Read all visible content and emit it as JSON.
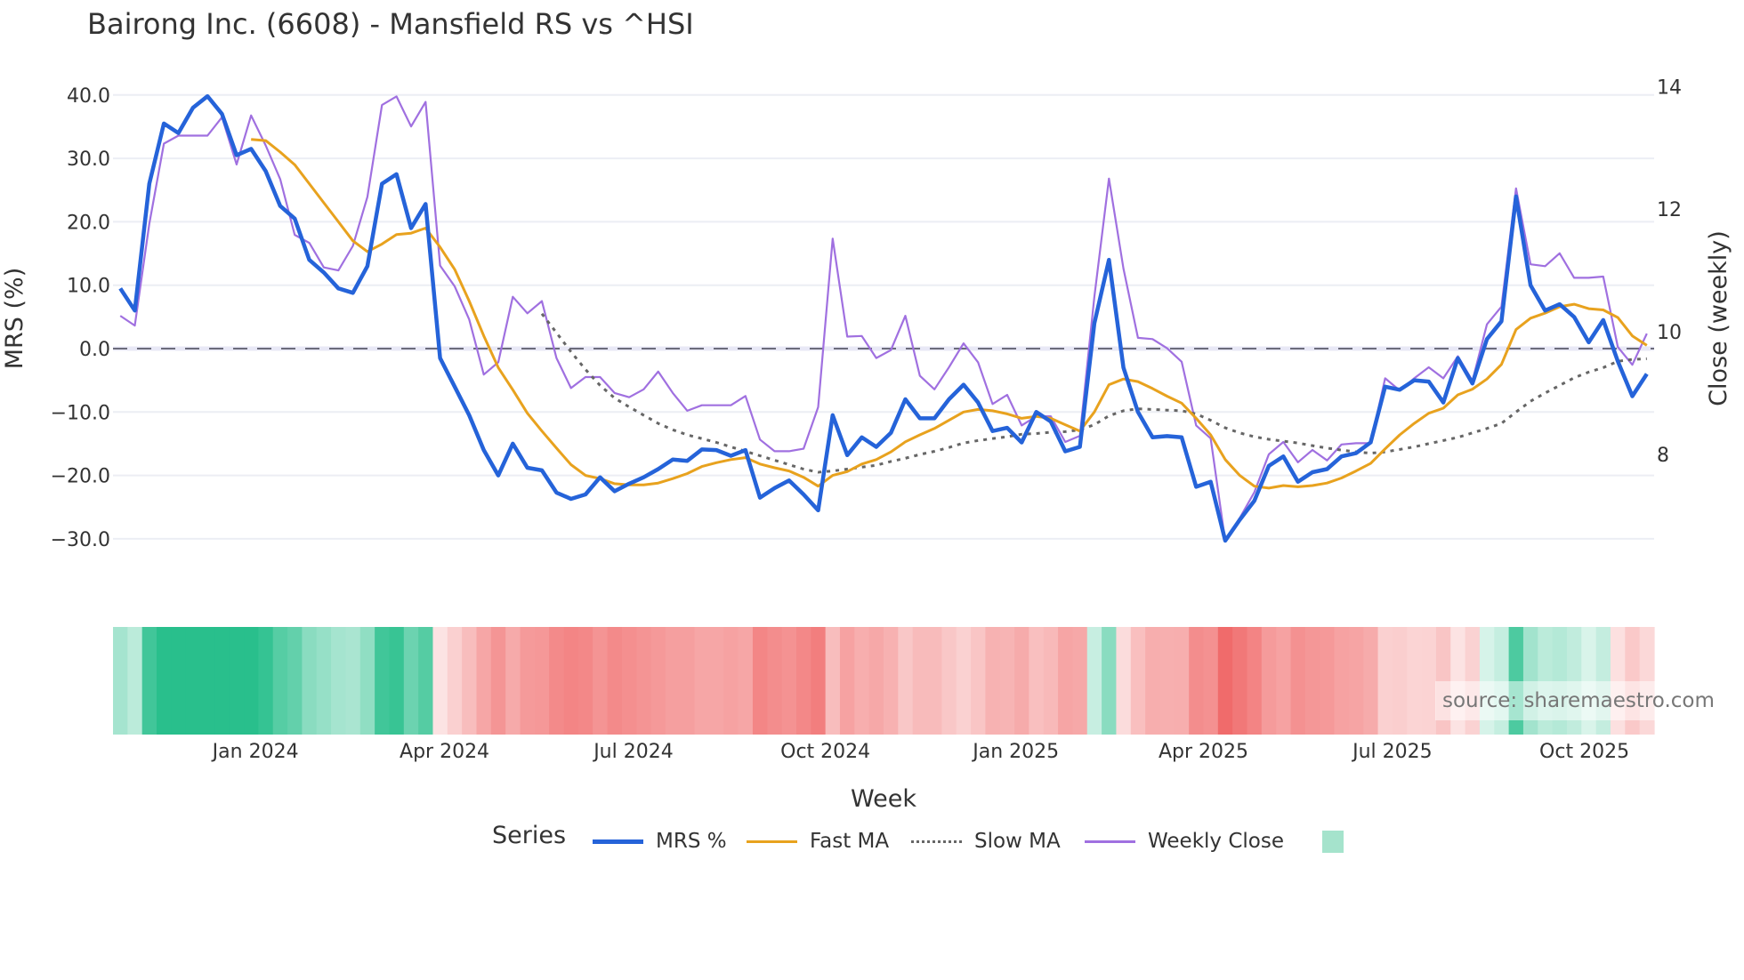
{
  "title": "Bairong Inc. (6608) - Mansfield RS vs ^HSI",
  "source": "source: sharemaestro.com",
  "legend": {
    "title": "Series",
    "items": [
      "MRS %",
      "Fast MA",
      "Slow MA",
      "Weekly Close",
      ""
    ]
  },
  "colors": {
    "mrs": "#2563d9",
    "fast_ma": "#e8a21e",
    "slow_ma": "#666666",
    "weekly_close": "#a070e0",
    "heat_pos": "#29bf8c",
    "heat_neg": "#f06b6b",
    "grid": "#eceef4",
    "zero_line": "#6b6b7b"
  },
  "chart_data": {
    "type": "line",
    "title": "Bairong Inc. (6608) - Mansfield RS vs ^HSI",
    "xlabel": "Week",
    "ylabel": "MRS (%)",
    "y2label": "Close (weekly)",
    "ylim": [
      -35,
      42.5
    ],
    "y2lim": [
      6.3,
      14.3
    ],
    "yticks": [
      "40.0",
      "30.0",
      "20.0",
      "10.0",
      "0.0",
      "−10.0",
      "−20.0",
      "−30.0"
    ],
    "ytick_values": [
      40,
      30,
      20,
      10,
      0,
      -10,
      -20,
      -30
    ],
    "y2ticks": [
      "14",
      "12",
      "10",
      "8"
    ],
    "y2tick_values": [
      14,
      12,
      10,
      8
    ],
    "xticks": [
      {
        "label": "Jan 2024",
        "week_index": 9.3
      },
      {
        "label": "Apr 2024",
        "week_index": 22.3
      },
      {
        "label": "Jul 2024",
        "week_index": 35.3
      },
      {
        "label": "Oct 2024",
        "week_index": 48.5
      },
      {
        "label": "Jan 2025",
        "week_index": 61.6
      },
      {
        "label": "Apr 2025",
        "week_index": 74.5
      },
      {
        "label": "Jul 2025",
        "week_index": 87.5
      },
      {
        "label": "Oct 2025",
        "week_index": 100.7
      }
    ],
    "n_weeks": 106,
    "grid": true,
    "legend_position": "bottom-center",
    "series": [
      {
        "name": "MRS %",
        "axis": "y",
        "values": [
          9.5,
          6,
          26,
          35.5,
          34,
          38,
          39.8,
          37,
          30.5,
          31.5,
          28,
          22.5,
          20.5,
          14,
          12,
          9.5,
          8.8,
          13,
          26,
          27.5,
          19,
          22.8,
          -1.5,
          -6,
          -10.5,
          -16,
          -20,
          -15,
          -18.8,
          -19.2,
          -22.7,
          -23.7,
          -23,
          -20.3,
          -22.5,
          -21.3,
          -20.3,
          -19,
          -17.5,
          -17.7,
          -15.9,
          -16,
          -16.9,
          -16,
          -23.5,
          -22,
          -20.8,
          -23,
          -25.5,
          -10.5,
          -16.8,
          -14,
          -15.5,
          -13.3,
          -8,
          -11,
          -11,
          -8,
          -5.7,
          -8.5,
          -13,
          -12.5,
          -14.8,
          -10,
          -11.5,
          -16.2,
          -15.5,
          4,
          14,
          -3,
          -10,
          -14,
          -13.8,
          -14,
          -21.8,
          -21,
          -30.3,
          -27,
          -24,
          -18.5,
          -17,
          -21,
          -19.5,
          -19,
          -17,
          -16.5,
          -14.8,
          -6,
          -6.5,
          -5,
          -5.2,
          -8.5,
          -1.5,
          -5.5,
          1.5,
          4.3,
          24,
          10,
          6,
          7,
          5,
          1,
          4.5,
          -2,
          -7.5,
          -4
        ]
      },
      {
        "name": "Fast MA",
        "axis": "y",
        "values": [
          null,
          null,
          null,
          null,
          null,
          null,
          null,
          null,
          null,
          33,
          32.8,
          31,
          29,
          26,
          23,
          20,
          17,
          15.3,
          16.5,
          18,
          18.2,
          19,
          16,
          12.5,
          7.5,
          2,
          -3,
          -6.5,
          -10.2,
          -13,
          -15.7,
          -18.3,
          -20,
          -20.5,
          -21.3,
          -21.5,
          -21.5,
          -21.2,
          -20.5,
          -19.7,
          -18.6,
          -18,
          -17.5,
          -17.2,
          -18.2,
          -18.8,
          -19.3,
          -20.3,
          -21.7,
          -20,
          -19.4,
          -18.2,
          -17.5,
          -16.3,
          -14.7,
          -13.6,
          -12.6,
          -11.3,
          -10,
          -9.6,
          -9.8,
          -10.3,
          -11,
          -10.7,
          -11,
          -12,
          -13,
          -10,
          -5.7,
          -4.8,
          -5.2,
          -6.3,
          -7.5,
          -8.6,
          -11,
          -13.6,
          -17.5,
          -20,
          -21.7,
          -22,
          -21.6,
          -21.8,
          -21.6,
          -21.2,
          -20.4,
          -19.3,
          -18.1,
          -15.8,
          -13.6,
          -11.8,
          -10.2,
          -9.4,
          -7.3,
          -6.4,
          -4.8,
          -2.5,
          3,
          4.8,
          5.6,
          6.6,
          7,
          6.3,
          6.1,
          4.9,
          2,
          0.5
        ]
      },
      {
        "name": "Slow MA",
        "axis": "y",
        "values": [
          null,
          null,
          null,
          null,
          null,
          null,
          null,
          null,
          null,
          null,
          null,
          null,
          null,
          null,
          null,
          null,
          null,
          null,
          null,
          null,
          null,
          null,
          null,
          null,
          null,
          null,
          null,
          null,
          null,
          5.5,
          2.5,
          -0.5,
          -3.3,
          -5.8,
          -7.8,
          -9.2,
          -10.5,
          -11.8,
          -12.8,
          -13.6,
          -14.2,
          -14.8,
          -15.5,
          -16.2,
          -16.9,
          -17.6,
          -18.3,
          -19,
          -19.5,
          -19.3,
          -19,
          -18.7,
          -18.4,
          -17.8,
          -17.3,
          -16.7,
          -16.2,
          -15.6,
          -14.9,
          -14.5,
          -14.2,
          -13.9,
          -13.5,
          -13.4,
          -13.2,
          -13.1,
          -12.8,
          -12,
          -10.6,
          -9.8,
          -9.5,
          -9.6,
          -9.7,
          -9.8,
          -10.3,
          -11.3,
          -12.5,
          -13.3,
          -13.9,
          -14.3,
          -14.6,
          -14.9,
          -15.3,
          -15.7,
          -16,
          -16.3,
          -16.5,
          -16.3,
          -15.9,
          -15.5,
          -15,
          -14.5,
          -14,
          -13.3,
          -12.6,
          -11.8,
          -10,
          -8.3,
          -7,
          -5.8,
          -4.6,
          -3.7,
          -3,
          -2,
          -1.7,
          -1.6
        ]
      },
      {
        "name": "Weekly Close",
        "axis": "y2",
        "values": [
          10.26,
          10.1,
          11.76,
          13.07,
          13.2,
          13.2,
          13.2,
          13.5,
          12.73,
          13.53,
          13.04,
          12.49,
          11.58,
          11.45,
          11.05,
          11.0,
          11.4,
          12.2,
          13.7,
          13.84,
          13.35,
          13.75,
          11.08,
          10.74,
          10.2,
          9.3,
          9.5,
          10.57,
          10.3,
          10.5,
          9.57,
          9.08,
          9.26,
          9.26,
          9.0,
          8.93,
          9.06,
          9.35,
          9.0,
          8.71,
          8.8,
          8.8,
          8.8,
          8.95,
          8.24,
          8.05,
          8.05,
          8.09,
          8.77,
          11.52,
          9.92,
          9.93,
          9.57,
          9.7,
          10.26,
          9.28,
          9.06,
          9.42,
          9.81,
          9.5,
          8.82,
          8.97,
          8.47,
          8.62,
          8.62,
          8.2,
          8.3,
          10.57,
          12.5,
          11.03,
          9.9,
          9.88,
          9.73,
          9.51,
          8.47,
          8.26,
          6.58,
          6.96,
          7.38,
          8.0,
          8.2,
          7.87,
          8.07,
          7.9,
          8.16,
          8.18,
          8.18,
          9.24,
          9.04,
          9.24,
          9.42,
          9.24,
          9.6,
          9.2,
          10.12,
          10.41,
          12.34,
          11.1,
          11.07,
          11.28,
          10.88,
          10.88,
          10.9,
          9.75,
          9.46,
          9.97
        ]
      }
    ],
    "heatmap": {
      "source_series": "MRS %",
      "zlim": [
        -30,
        30
      ]
    }
  }
}
